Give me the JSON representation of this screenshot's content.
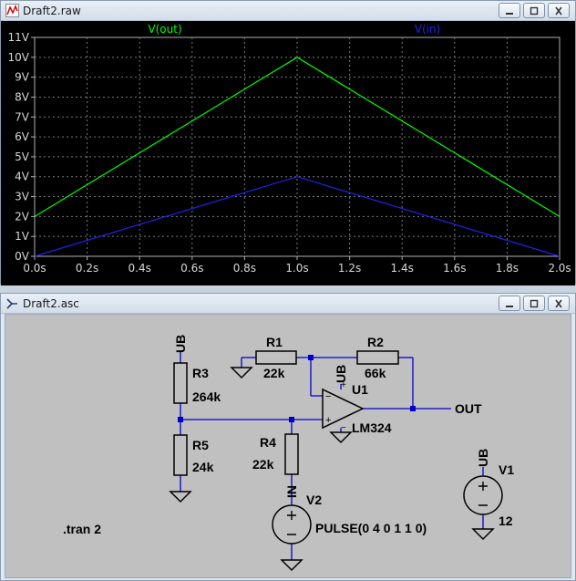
{
  "plot_window": {
    "title": "Draft2.raw",
    "buttons": [
      "minimize",
      "restore",
      "close"
    ]
  },
  "schematic_window": {
    "title": "Draft2.asc",
    "buttons": [
      "minimize",
      "restore",
      "close"
    ]
  },
  "chart_data": {
    "type": "line",
    "x_ticks": [
      "0.0s",
      "0.2s",
      "0.4s",
      "0.6s",
      "0.8s",
      "1.0s",
      "1.2s",
      "1.4s",
      "1.6s",
      "1.8s",
      "2.0s"
    ],
    "y_ticks": [
      "0V",
      "1V",
      "2V",
      "3V",
      "4V",
      "5V",
      "6V",
      "7V",
      "8V",
      "9V",
      "10V",
      "11V"
    ],
    "xlim": [
      0,
      2
    ],
    "ylim": [
      0,
      11
    ],
    "grid": true,
    "series": [
      {
        "name": "V(out)",
        "color": "#00ff00",
        "x": [
          0,
          1,
          2
        ],
        "y": [
          2,
          10,
          2
        ]
      },
      {
        "name": "V(in)",
        "color": "#2222ee",
        "x": [
          0,
          1,
          2
        ],
        "y": [
          0,
          4,
          0
        ]
      }
    ]
  },
  "schematic": {
    "r1": {
      "name": "R1",
      "value": "22k"
    },
    "r2": {
      "name": "R2",
      "value": "66k"
    },
    "r3": {
      "name": "R3",
      "value": "264k"
    },
    "r4": {
      "name": "R4",
      "value": "22k"
    },
    "r5": {
      "name": "R5",
      "value": "24k"
    },
    "u1": {
      "name": "U1",
      "part": "LM324"
    },
    "v1": {
      "name": "V1",
      "value": "12"
    },
    "v2": {
      "name": "V2",
      "value": "PULSE(0 4 0 1 1 0)"
    },
    "net_ub_r3": "UB",
    "net_ub_u1": "UB",
    "net_ub_v1": "UB",
    "net_in": "IN",
    "net_out": "OUT",
    "directive": ".tran 2"
  }
}
